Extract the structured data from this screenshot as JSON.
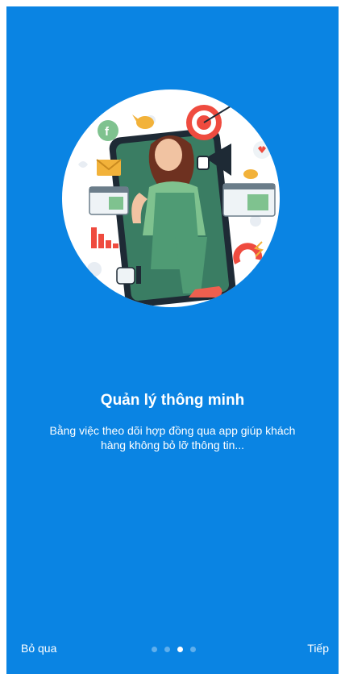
{
  "onboarding": {
    "title": "Quản lý thông minh",
    "description": "Bằng việc theo dõi hợp đồng qua app giúp khách hàng không bỏ lỡ thông tin...",
    "skip_label": "Bỏ qua",
    "next_label": "Tiếp",
    "page_count": 4,
    "active_page": 3
  },
  "illustration": {
    "icons": [
      "facebook-icon",
      "mail-icon",
      "target-icon",
      "megaphone-icon",
      "bird-icon",
      "magnet-icon",
      "thumbs-up-icon",
      "bar-chart-icon",
      "heart-bubble-icon",
      "browser-window-icon"
    ]
  },
  "colors": {
    "background": "#0a84e3",
    "text": "#ffffff",
    "dot_inactive": "rgba(255,255,255,0.35)",
    "dot_active": "#ffffff"
  }
}
